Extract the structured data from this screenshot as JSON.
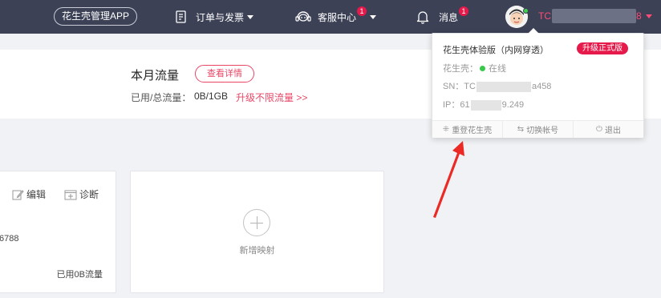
{
  "topbar": {
    "app_button": "花生壳管理APP",
    "orders_label": "订单与发票",
    "service_label": "客服中心",
    "service_badge": "1",
    "messages_label": "消息",
    "messages_badge": "1",
    "user_prefix": "TC",
    "user_suffix": "8"
  },
  "traffic": {
    "title": "本月流量",
    "detail_button": "查看详情",
    "used_label": "已用/总流量：",
    "used_value": "0B/1GB",
    "upgrade_link": "升级不限流量 >>"
  },
  "mapping_card": {
    "edit_label": "编辑",
    "diagnose_label": "诊断",
    "port_text": "6788",
    "used_traffic": "已用0B流量"
  },
  "add_card": {
    "label": "新增映射"
  },
  "dropdown": {
    "edition": "花生壳体验版（内网穿透）",
    "upgrade_button": "升级正式版",
    "status_label": "花生壳：",
    "status_value": "在线",
    "sn_prefix": "SN：TC",
    "sn_suffix": "a458",
    "ip_prefix": "IP：61",
    "ip_suffix": "9.249",
    "relogin": "重登花生壳",
    "switch_account": "切换帐号",
    "logout": "退出"
  },
  "colors": {
    "topbar_bg": "#3c4156",
    "accent": "#e6194b",
    "online": "#38c94a"
  }
}
